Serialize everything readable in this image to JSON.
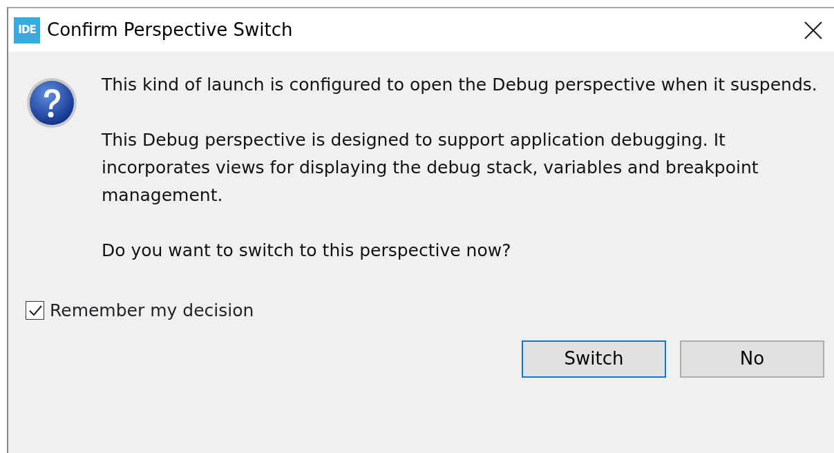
{
  "window": {
    "logo_text": "IDE",
    "title": "Confirm Perspective Switch"
  },
  "message": {
    "paragraphs": [
      "This kind of launch is configured to open the Debug perspective when it suspends.",
      "This Debug perspective is designed to support application debugging. It incorporates views for displaying the debug stack, variables and breakpoint management.",
      "Do you want to switch to this perspective now?"
    ]
  },
  "remember": {
    "label": "Remember my decision",
    "checked": true
  },
  "buttons": [
    {
      "label": "Switch",
      "default": true
    },
    {
      "label": "No",
      "default": false
    }
  ]
}
